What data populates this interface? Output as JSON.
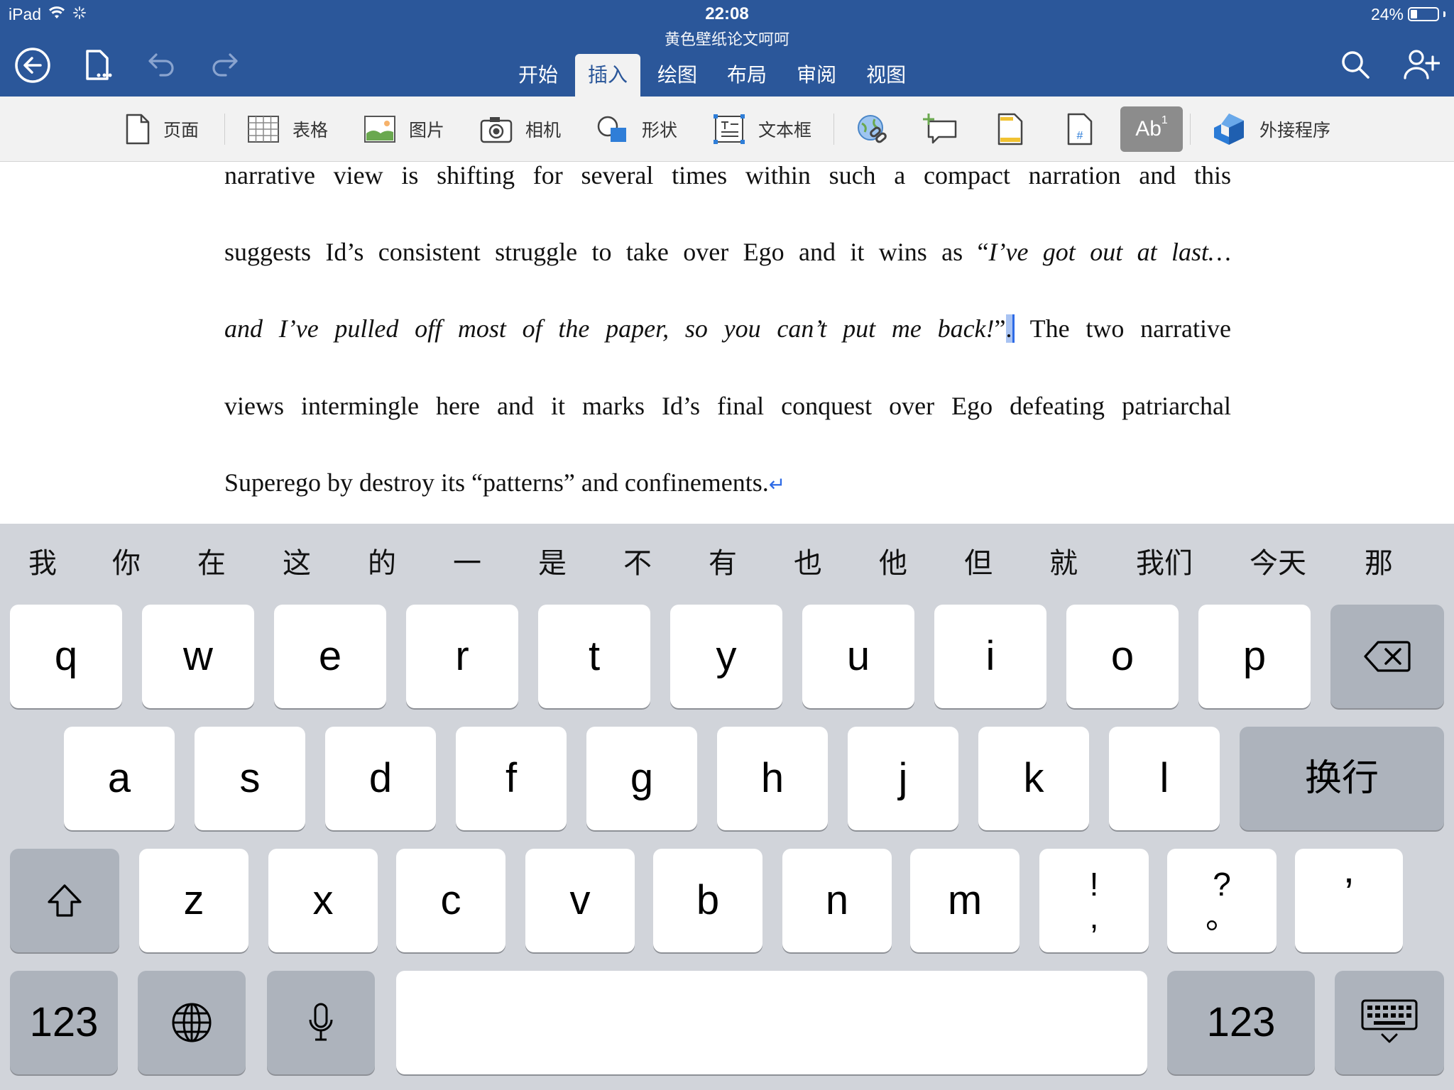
{
  "status_bar": {
    "device": "iPad",
    "time": "22:08",
    "battery_percent": "24%",
    "battery_level": 0.24
  },
  "document_title": "黄色壁纸论文呵呵",
  "header": {
    "buttons": [
      "back",
      "file",
      "undo",
      "redo",
      "search",
      "share-person"
    ],
    "tabs": [
      "开始",
      "插入",
      "绘图",
      "布局",
      "审阅",
      "视图"
    ],
    "active_tab": "插入"
  },
  "ribbon": {
    "page": "页面",
    "table": "表格",
    "picture": "图片",
    "camera": "相机",
    "shapes": "形状",
    "textbox": "文本框",
    "footnote_label": "Ab",
    "footnote_sup": "1",
    "addins": "外接程序"
  },
  "document": {
    "line1": "narrative view is shifting for several times within such a compact narration and this",
    "line2_a": "suggests Id’s consistent struggle to take over Ego and it wins as “",
    "line2_b": "I’ve got out at last…",
    "line3_a": "and I’ve pulled off most of the paper, so you can’t put me back!",
    "line3_b": "”",
    "line3_cursor": ".",
    "line3_c": " The two narrative",
    "line4": "views intermingle here and it marks Id’s final conquest over Ego defeating patriarchal",
    "line5": "Superego by destroy its “patterns” and confinements.",
    "para_mark": "↵"
  },
  "keyboard": {
    "candidates": [
      "我",
      "你",
      "在",
      "这",
      "的",
      "一",
      "是",
      "不",
      "有",
      "也",
      "他",
      "但",
      "就",
      "我们",
      "今天",
      "那"
    ],
    "row1": [
      "q",
      "w",
      "e",
      "r",
      "t",
      "y",
      "u",
      "i",
      "o",
      "p"
    ],
    "row2": [
      "a",
      "s",
      "d",
      "f",
      "g",
      "h",
      "j",
      "k",
      "l"
    ],
    "return": "换行",
    "row3": [
      "z",
      "x",
      "c",
      "v",
      "b",
      "n",
      "m"
    ],
    "punct1_top": "!",
    "punct1_bottom": ",",
    "punct2_top": "?",
    "punct2_bottom": "。",
    "punct3": "’",
    "numbers_left": "123",
    "numbers_right": "123",
    "space": ""
  },
  "colors": {
    "header_blue": "#2b579a",
    "ribbon_bg": "#f2f2f2",
    "keyboard_bg": "#d1d4da",
    "cursor_blue": "#2e6be6"
  }
}
